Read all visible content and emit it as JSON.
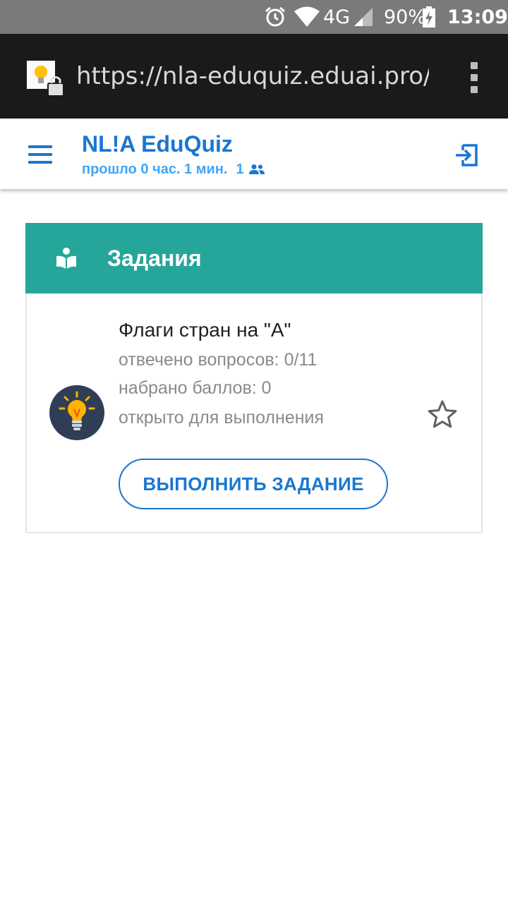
{
  "status_bar": {
    "network": "4G",
    "battery": "90%",
    "time": "13:09",
    "icons": [
      "alarm-icon",
      "wifi-icon",
      "signal-icon",
      "battery-charging-icon"
    ]
  },
  "browser": {
    "url": "https://nla-eduquiz.eduai.pro/?g",
    "icons": [
      "site-lock-favicon",
      "overflow-menu-icon"
    ]
  },
  "header": {
    "title": "NL!A EduQuiz",
    "elapsed": "прошло 0 час. 1 мин.",
    "participants": "1",
    "icons": [
      "menu-icon",
      "people-icon",
      "logout-icon"
    ],
    "accent_color": "#1976d2"
  },
  "tasks": {
    "title": "Задания",
    "header_color": "#26a69a",
    "items": [
      {
        "title": "Флаги стран на \"A\"",
        "answered": "отвечено вопросов: 0/11",
        "points": "набрано баллов: 0",
        "status": "открыто для выполнения",
        "button": "ВЫПОЛНИТЬ ЗАДАНИЕ",
        "favorite": false,
        "icon": "lightbulb-icon"
      }
    ]
  }
}
